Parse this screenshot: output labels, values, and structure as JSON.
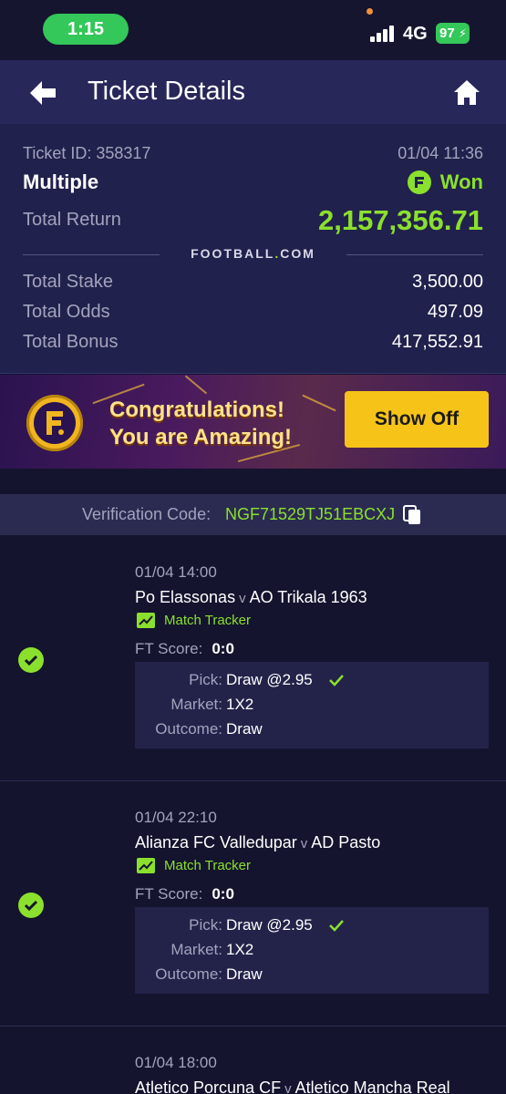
{
  "status_bar": {
    "time": "1:15",
    "network": "4G",
    "battery": "97"
  },
  "header": {
    "title": "Ticket Details"
  },
  "ticket": {
    "id_label": "Ticket ID: 358317",
    "datetime": "01/04 11:36",
    "type": "Multiple",
    "status": "Won",
    "total_return_label": "Total Return",
    "total_return_value": "2,157,356.71",
    "brand": "FOOTBALL",
    "brand_dot": ".",
    "brand_suffix": "COM",
    "stats": [
      {
        "label": "Total Stake",
        "value": "3,500.00"
      },
      {
        "label": "Total Odds",
        "value": "497.09"
      },
      {
        "label": "Total Bonus",
        "value": "417,552.91"
      }
    ]
  },
  "banner": {
    "line1": "Congratulations!",
    "line2": "You are Amazing!",
    "button": "Show Off"
  },
  "verification": {
    "label": "Verification Code:",
    "code": "NGF71529TJ51EBCXJ"
  },
  "selections": [
    {
      "date": "01/04 14:00",
      "home": "Po Elassonas",
      "vs": "v",
      "away": "AO Trikala 1963",
      "tracker": "Match Tracker",
      "score_label": "FT Score:",
      "score": "0:0",
      "pick_label": "Pick:",
      "pick": "Draw @2.95",
      "market_label": "Market:",
      "market": "1X2",
      "outcome_label": "Outcome:",
      "outcome": "Draw"
    },
    {
      "date": "01/04 22:10",
      "home": "Alianza FC Valledupar",
      "vs": "v",
      "away": "AD Pasto",
      "tracker": "Match Tracker",
      "score_label": "FT Score:",
      "score": "0:0",
      "pick_label": "Pick:",
      "pick": "Draw @2.95",
      "market_label": "Market:",
      "market": "1X2",
      "outcome_label": "Outcome:",
      "outcome": "Draw"
    },
    {
      "date": "01/04 18:00",
      "home": "Atletico Porcuna CF",
      "vs": "v",
      "away": "Atletico Mancha Real"
    }
  ],
  "colors": {
    "accent_green": "#8be02d",
    "button_yellow": "#f6c419",
    "header_bg": "#27275a"
  }
}
